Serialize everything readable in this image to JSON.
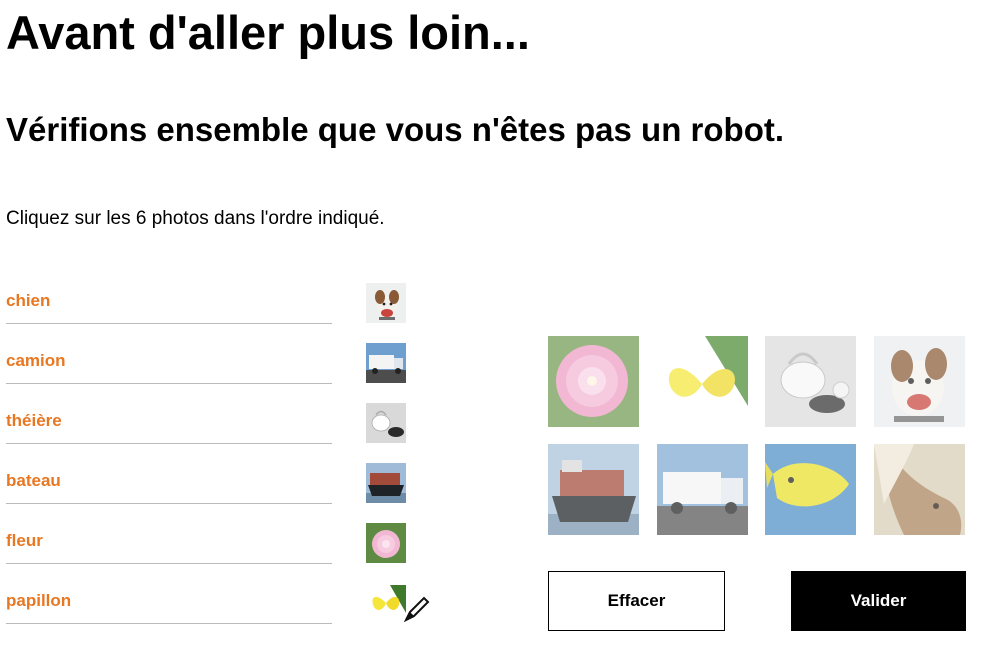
{
  "page": {
    "title": "Avant d'aller plus loin...",
    "subtitle": "Vérifions ensemble que vous n'êtes pas un robot.",
    "instruction": "Cliquez sur les 6 photos dans l'ordre indiqué."
  },
  "order": [
    {
      "label": "chien",
      "icon": "dog-photo-icon"
    },
    {
      "label": "camion",
      "icon": "truck-photo-icon"
    },
    {
      "label": "théière",
      "icon": "teapot-photo-icon"
    },
    {
      "label": "bateau",
      "icon": "ship-photo-icon"
    },
    {
      "label": "fleur",
      "icon": "flower-photo-icon"
    },
    {
      "label": "papillon",
      "icon": "butterfly-photo-icon"
    }
  ],
  "grid": [
    "flower",
    "butterfly",
    "teapot",
    "dog",
    "ship",
    "truck",
    "fish",
    "horse"
  ],
  "buttons": {
    "clear": "Effacer",
    "validate": "Valider"
  },
  "colors": {
    "accent": "#e87722",
    "divider": "#bbbbbb",
    "primary_button": "#000000"
  }
}
